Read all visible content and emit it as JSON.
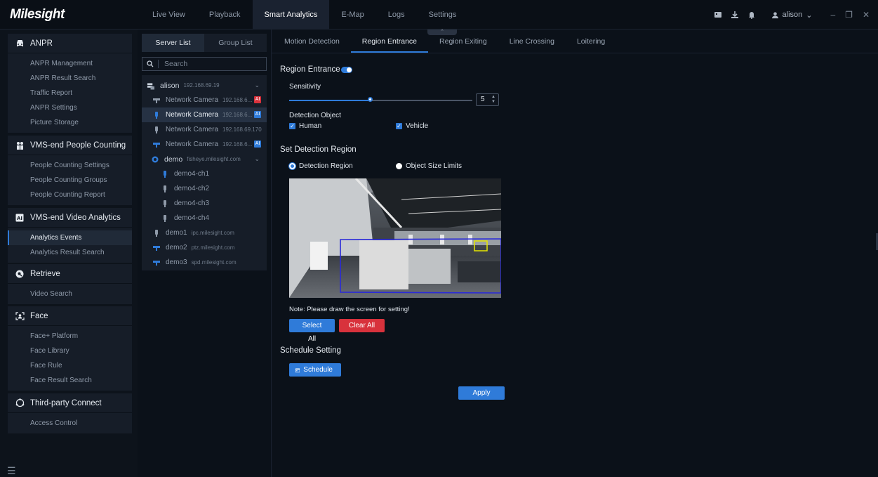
{
  "brand": {
    "logo": "Milesight"
  },
  "nav": {
    "tabs": [
      {
        "label": "Live View"
      },
      {
        "label": "Playback"
      },
      {
        "label": "Smart Analytics"
      },
      {
        "label": "E-Map"
      },
      {
        "label": "Logs"
      },
      {
        "label": "Settings"
      }
    ],
    "active": "Smart Analytics"
  },
  "user": {
    "name": "alison"
  },
  "sidebar": {
    "groups": [
      {
        "title": "ANPR",
        "icon": "car-icon",
        "items": [
          "ANPR Management",
          "ANPR Result Search",
          "Traffic Report",
          "ANPR Settings",
          "Picture Storage"
        ]
      },
      {
        "title": "VMS-end People Counting",
        "icon": "people-icon",
        "items": [
          "People Counting Settings",
          "People Counting Groups",
          "People Counting Report"
        ]
      },
      {
        "title": "VMS-end Video Analytics",
        "icon": "ai-icon",
        "items": [
          "Analytics Events",
          "Analytics Result Search"
        ]
      },
      {
        "title": "Retrieve",
        "icon": "retrieve-icon",
        "items": [
          "Video Search"
        ]
      },
      {
        "title": "Face",
        "icon": "face-icon",
        "items": [
          "Face+ Platform",
          "Face Library",
          "Face Rule",
          "Face Result Search"
        ]
      },
      {
        "title": "Third-party Connect",
        "icon": "connect-icon",
        "items": [
          "Access Control"
        ]
      }
    ],
    "active_item": "Analytics Events"
  },
  "devices": {
    "tabs": [
      "Server List",
      "Group List"
    ],
    "search_placeholder": "Search",
    "server": {
      "name": "alison",
      "ip": "192.168.69.19"
    },
    "cameras": [
      {
        "name": "Network Camera",
        "ip": "192.168.6...",
        "badge": "AI",
        "badge_color": "#d8323c",
        "icon": "ptz-camera-icon"
      },
      {
        "name": "Network Camera",
        "ip": "192.168.6...",
        "badge": "AI",
        "badge_color": "#2f7bd9",
        "icon": "bullet-camera-icon"
      },
      {
        "name": "Network Camera",
        "ip": "192.168.69.170",
        "badge": "",
        "icon": "bullet-camera-icon"
      },
      {
        "name": "Network Camera",
        "ip": "192.168.6...",
        "badge": "AI",
        "badge_color": "#2f7bd9",
        "icon": "ptz-camera-icon"
      }
    ],
    "demo": {
      "name": "demo",
      "host": "fisheye.milesight.com",
      "channels": [
        "demo4-ch1",
        "demo4-ch2",
        "demo4-ch3",
        "demo4-ch4"
      ]
    },
    "others": [
      {
        "name": "demo1",
        "host": "ipc.milesight.com"
      },
      {
        "name": "demo2",
        "host": "ptz.milesight.com"
      },
      {
        "name": "demo3",
        "host": "spd.milesight.com"
      }
    ]
  },
  "analytics": {
    "tabs": [
      "Motion Detection",
      "Region Entrance",
      "Region Exiting",
      "Line Crossing",
      "Loitering"
    ],
    "active_tab": "Region Entrance",
    "region_entrance_label": "Region Entrance",
    "region_entrance_enabled": true,
    "sensitivity_label": "Sensitivity",
    "sensitivity_value": "5",
    "sensitivity_fraction": 0.45,
    "detection_object_label": "Detection Object",
    "objects": [
      {
        "label": "Human",
        "checked": true
      },
      {
        "label": "Vehicle",
        "checked": true
      }
    ],
    "set_region_title": "Set Detection Region",
    "region_modes": [
      {
        "label": "Detection Region",
        "selected": true
      },
      {
        "label": "Object Size Limits",
        "selected": false
      }
    ],
    "note": "Note: Please draw the screen for setting!",
    "select_all": "Select All",
    "clear_all": "Clear All",
    "schedule_title": "Schedule Setting",
    "schedule_button": "Schedule",
    "apply": "Apply"
  },
  "colors": {
    "accent": "#2f7bd9",
    "danger": "#d8323c",
    "region_line": "#2a2ad8",
    "object_box": "#e6e600"
  }
}
